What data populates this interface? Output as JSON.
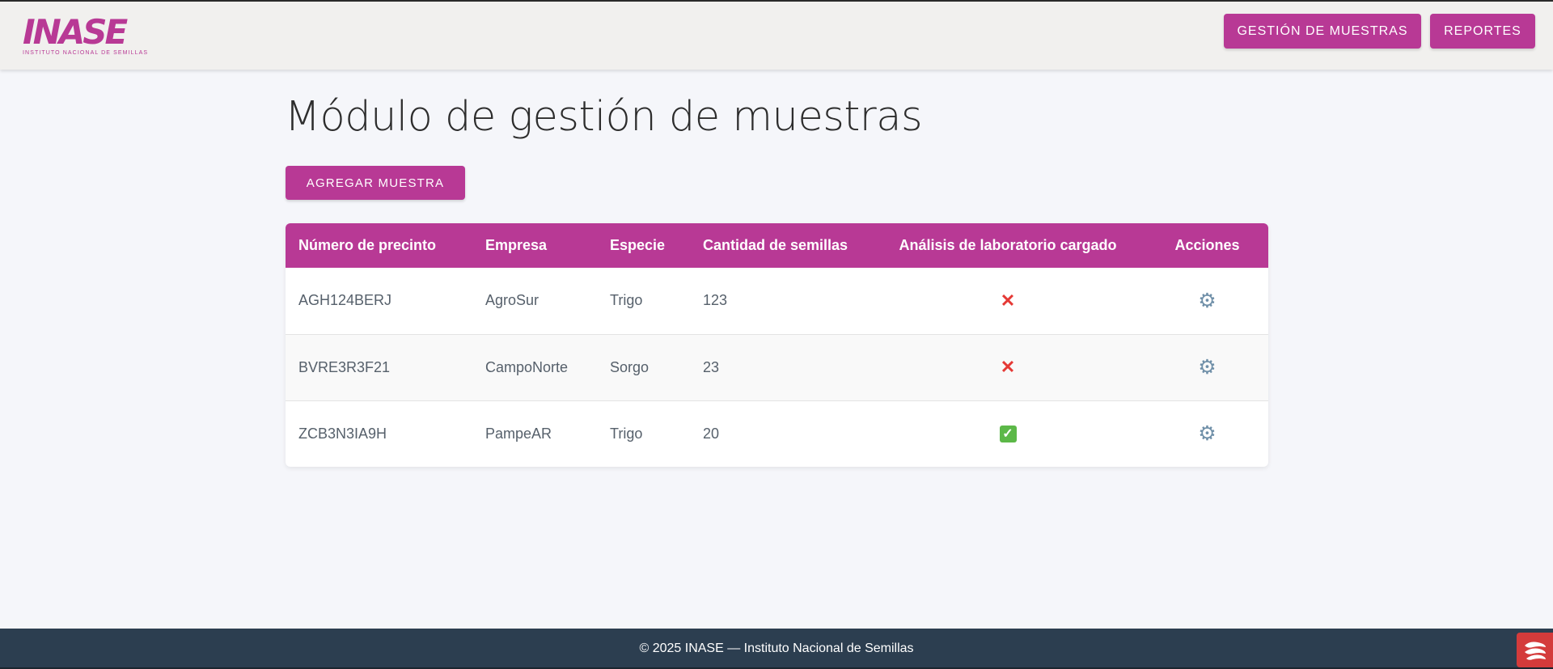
{
  "brand": {
    "logo_text": "INASE",
    "logo_subtitle": "INSTITUTO  NACIONAL DE SEMILLAS",
    "color": "#b83995"
  },
  "nav": {
    "muestras_label": "GESTIÓN DE MUESTRAS",
    "reportes_label": "REPORTES"
  },
  "page": {
    "title": "Módulo de gestión de muestras",
    "add_button_label": "AGREGAR MUESTRA"
  },
  "table": {
    "headers": {
      "precinto": "Número de precinto",
      "empresa": "Empresa",
      "especie": "Especie",
      "cantidad": "Cantidad de semillas",
      "analisis": "Análisis de laboratorio cargado",
      "acciones": "Acciones"
    },
    "rows": [
      {
        "precinto": "AGH124BERJ",
        "empresa": "AgroSur",
        "especie": "Trigo",
        "cantidad": "123",
        "analisis_loaded": false,
        "analisis_icon": "cross-mark-icon",
        "accion_icon": "gear-icon"
      },
      {
        "precinto": "BVRE3R3F21",
        "empresa": "CampoNorte",
        "especie": "Sorgo",
        "cantidad": "23",
        "analisis_loaded": false,
        "analisis_icon": "cross-mark-icon",
        "accion_icon": "gear-icon"
      },
      {
        "precinto": "ZCB3N3IA9H",
        "empresa": "PampeAR",
        "especie": "Trigo",
        "cantidad": "20",
        "analisis_loaded": true,
        "analisis_icon": "check-mark-icon",
        "accion_icon": "gear-icon"
      }
    ]
  },
  "footer": {
    "text": "© 2025 INASE — Instituto Nacional de Semillas"
  },
  "colors": {
    "primary": "#b83995",
    "footer_bg": "#2c3e50",
    "page_bg": "#f5f6fa",
    "header_bg": "#f1f0ee"
  }
}
